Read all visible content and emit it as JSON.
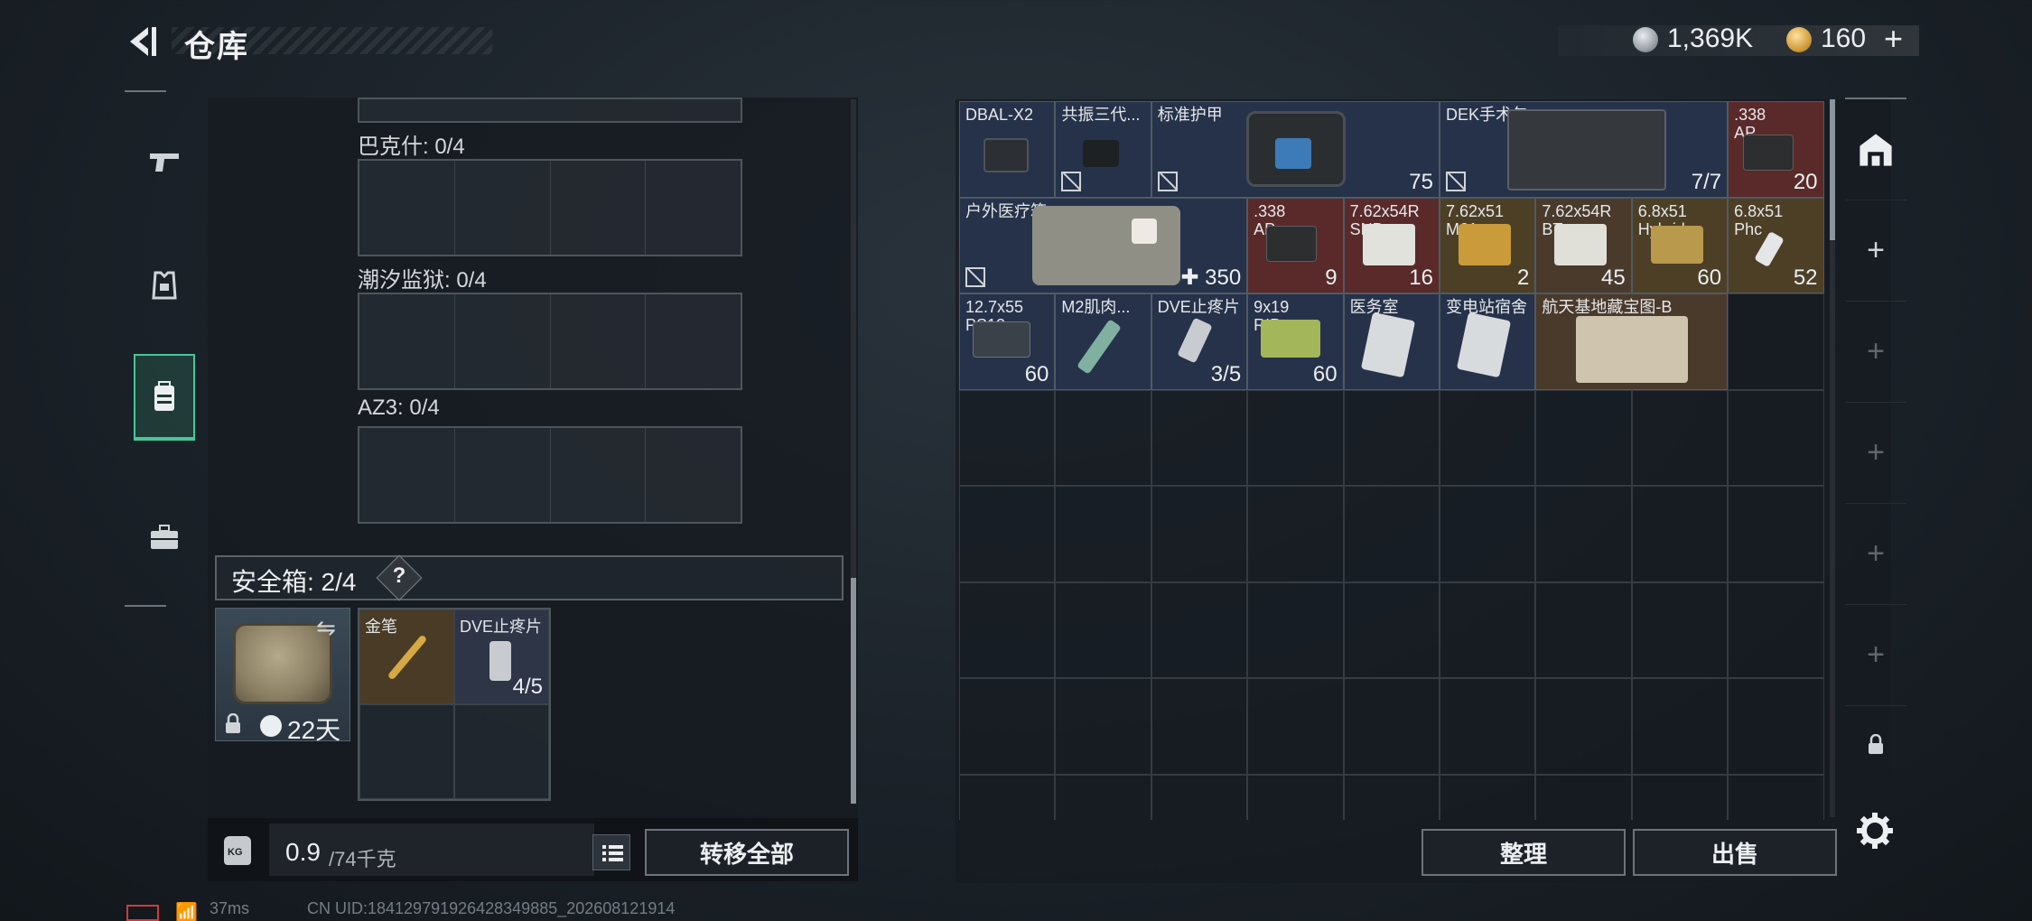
{
  "header": {
    "title": "仓库",
    "currency_silver": "1,369K",
    "currency_gold": "160",
    "plus": "+"
  },
  "left_tabs": [
    {
      "icon": "pistol-icon"
    },
    {
      "icon": "armor-vest-icon"
    },
    {
      "icon": "backpack-icon",
      "active": true
    },
    {
      "icon": "briefcase-icon"
    }
  ],
  "keycard_slots": [
    {
      "label": "巴克什: 0/4"
    },
    {
      "label": "潮汐监狱: 0/4"
    },
    {
      "label": "AZ3: 0/4"
    }
  ],
  "safe_box": {
    "label": "安全箱: 2/4",
    "help": "?",
    "duration": "22天",
    "items": [
      {
        "name": "金笔",
        "count": ""
      },
      {
        "name": "DVE止疼片",
        "count": "4/5"
      }
    ]
  },
  "footer_left": {
    "kg_label": "KG",
    "weight_value": "0.9",
    "weight_max": "/74千克",
    "transfer_all": "转移全部"
  },
  "stash": {
    "items": [
      {
        "name": "DBAL-X2",
        "count": "",
        "noicon": false
      },
      {
        "name": "共振三代...",
        "count": "",
        "noicon": true
      },
      {
        "name": "标准护甲",
        "count": "75",
        "noicon": true
      },
      {
        "name": "DEK手术包",
        "count": "7/7",
        "noicon": true
      },
      {
        "name": ".338\nAP",
        "count": "20",
        "noicon": false
      },
      {
        "name": "户外医疗箱",
        "count": "350",
        "noicon": true
      },
      {
        "name": ".338\nAP",
        "count": "9",
        "noicon": false
      },
      {
        "name": "7.62x54R\nSNB",
        "count": "16",
        "noicon": false
      },
      {
        "name": "7.62x51\nM61",
        "count": "2",
        "noicon": false
      },
      {
        "name": "7.62x54R\nBT",
        "count": "45",
        "noicon": false
      },
      {
        "name": "6.8x51\nHybrid",
        "count": "60",
        "noicon": false
      },
      {
        "name": "6.8x51\nPhc",
        "count": "52",
        "noicon": false
      },
      {
        "name": "12.7x55\nPS12",
        "count": "60",
        "noicon": false
      },
      {
        "name": "M2肌肉...",
        "count": "",
        "noicon": false
      },
      {
        "name": "DVE止疼片",
        "count": "3/5",
        "noicon": false
      },
      {
        "name": "9x19\nRIP",
        "count": "60",
        "noicon": false
      },
      {
        "name": "医务室",
        "count": "",
        "noicon": false
      },
      {
        "name": "变电站宿舍",
        "count": "",
        "noicon": false
      },
      {
        "name": "航天基地藏宝图-B",
        "count": "",
        "noicon": false
      }
    ],
    "tidy": "整理",
    "sell": "出售"
  },
  "side_tabs": [
    "+",
    "+",
    "+",
    "+",
    "+"
  ],
  "status": {
    "ping": "37ms",
    "uid": "CN UID:18412979192642834988​5_202608121914"
  },
  "colors": {
    "accent_green": "#46c79b",
    "rarity_red": "#5a2a2a",
    "rarity_gold": "#4d3f26",
    "rarity_blue": "#2d3548"
  }
}
